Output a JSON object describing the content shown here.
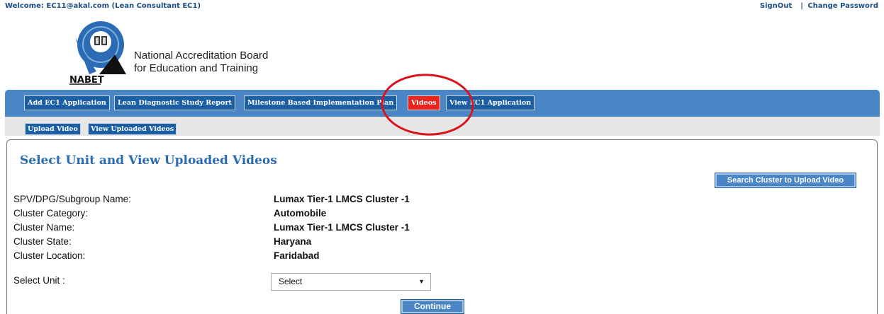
{
  "header": {
    "welcome_text": "Welcome: EC11@akal.com (Lean Consultant EC1)",
    "signout_label": "SignOut",
    "separator": "|",
    "change_password_label": "Change Password"
  },
  "logo": {
    "text": "NABET",
    "org_line1": "National Accreditation Board",
    "org_line2": "for Education and Training"
  },
  "nav": {
    "items": [
      {
        "label": "Add EC1 Application"
      },
      {
        "label": "Lean Diagnostic Study Report"
      },
      {
        "label": "Milestone Based Implementation Plan"
      },
      {
        "label": "Videos"
      },
      {
        "label": "View EC1 Application"
      }
    ]
  },
  "subnav": {
    "items": [
      {
        "label": "Upload Video"
      },
      {
        "label": "View Uploaded Videos"
      }
    ]
  },
  "main": {
    "title": "Select Unit and View Uploaded Videos",
    "search_button_label": "Search Cluster to Upload Video",
    "fields": [
      {
        "label": "SPV/DPG/Subgroup Name:",
        "value": "Lumax Tier-1 LMCS Cluster -1"
      },
      {
        "label": "Cluster Category:",
        "value": "Automobile"
      },
      {
        "label": "Cluster Name:",
        "value": "Lumax Tier-1 LMCS Cluster -1"
      },
      {
        "label": "Cluster State:",
        "value": "Haryana"
      },
      {
        "label": "Cluster Location:",
        "value": "Faridabad"
      }
    ],
    "select_unit_label": "Select Unit :",
    "select_unit_value": "Select",
    "continue_label": "Continue"
  },
  "colors": {
    "nav_bar": "#4a86c5",
    "nav_button": "#1d5fa3",
    "active_tab": "#e8241c",
    "title": "#2a6bb0",
    "annotation_ring": "#d8141c"
  }
}
